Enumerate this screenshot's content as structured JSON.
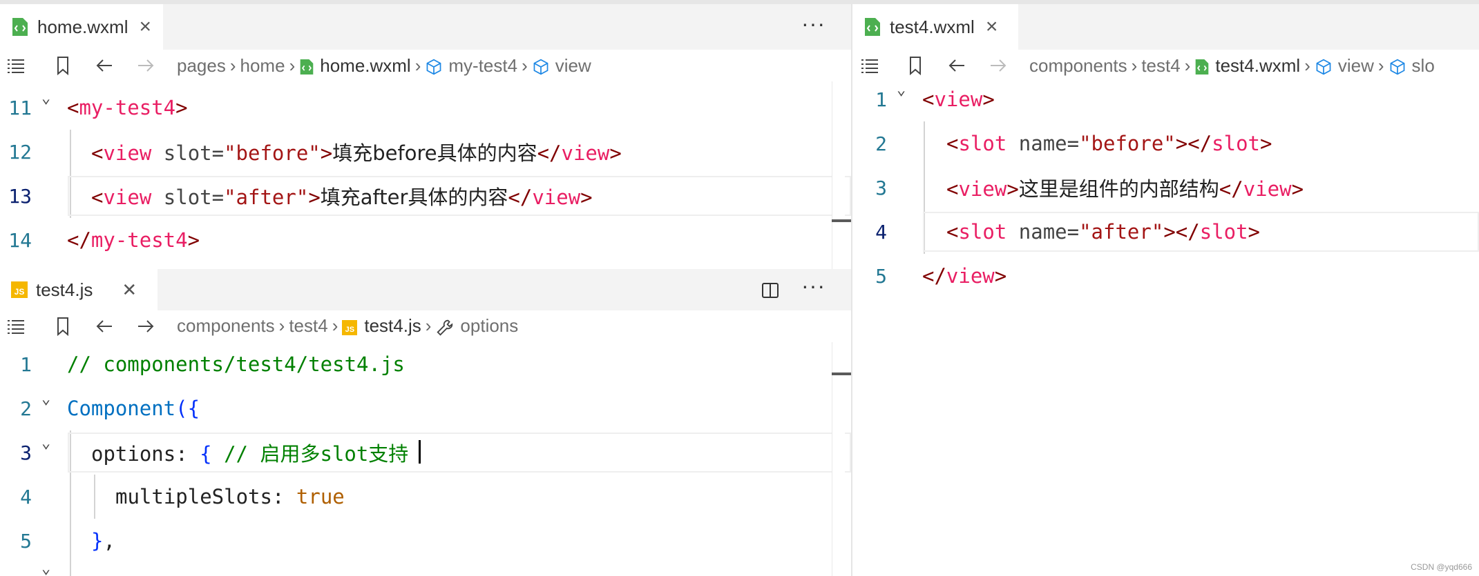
{
  "colors": {
    "tag": "#800000",
    "tagname": "#e91e63",
    "string": "#a31515",
    "comment": "#008000",
    "keyword": "#0070c1",
    "bool": "#af5f00"
  },
  "left_top": {
    "tab_label": "home.wxml",
    "tab_close": "×",
    "more": "···",
    "breadcrumb": [
      "pages",
      "home",
      "home.wxml",
      "my-test4",
      "view"
    ],
    "lines": [
      {
        "num": "11",
        "seg": [
          [
            "<",
            "t-tag"
          ],
          [
            "my-test4",
            "t-tagname"
          ],
          [
            ">",
            "t-tag"
          ]
        ]
      },
      {
        "num": "12",
        "seg": [
          [
            "<",
            "t-tag"
          ],
          [
            "view",
            "t-tagname"
          ],
          [
            " slot",
            "t-attr"
          ],
          [
            "=",
            "t-attr"
          ],
          [
            "\"before\"",
            "t-str"
          ],
          [
            ">",
            "t-tag"
          ],
          [
            "填充before具体的内容",
            "t-text"
          ],
          [
            "</",
            "t-tag"
          ],
          [
            "view",
            "t-tagname"
          ],
          [
            ">",
            "t-tag"
          ]
        ]
      },
      {
        "num": "13",
        "seg": [
          [
            "<",
            "t-tag"
          ],
          [
            "view",
            "t-tagname"
          ],
          [
            " slot",
            "t-attr"
          ],
          [
            "=",
            "t-attr"
          ],
          [
            "\"after\"",
            "t-str"
          ],
          [
            ">",
            "t-tag"
          ],
          [
            "填充after具体的内容",
            "t-text"
          ],
          [
            "</",
            "t-tag"
          ],
          [
            "view",
            "t-tagname"
          ],
          [
            ">",
            "t-tag"
          ]
        ]
      },
      {
        "num": "14",
        "seg": [
          [
            "</",
            "t-tag"
          ],
          [
            "my-test4",
            "t-tagname"
          ],
          [
            ">",
            "t-tag"
          ]
        ]
      }
    ]
  },
  "left_bottom": {
    "tab_label": "test4.js",
    "tab_close": "✕",
    "more": "···",
    "breadcrumb": [
      "components",
      "test4",
      "test4.js",
      "options"
    ],
    "lines": [
      {
        "num": "1",
        "seg": [
          [
            "// components/test4/test4.js",
            "t-com"
          ]
        ]
      },
      {
        "num": "2",
        "seg": [
          [
            "Component",
            "t-kw"
          ],
          [
            "(",
            "t-punc"
          ],
          [
            "{",
            "t-punc"
          ]
        ]
      },
      {
        "num": "3",
        "seg": [
          [
            "options",
            "t-prop"
          ],
          [
            ": ",
            "t-prop"
          ],
          [
            "{",
            "t-punc"
          ],
          [
            " // 启用多slot支持",
            "t-com"
          ]
        ]
      },
      {
        "num": "4",
        "seg": [
          [
            "multipleSlots",
            "t-prop"
          ],
          [
            ": ",
            "t-prop"
          ],
          [
            "true",
            "t-bool"
          ]
        ]
      },
      {
        "num": "5",
        "seg": [
          [
            "}",
            "t-punc"
          ],
          [
            ",",
            "t-prop"
          ]
        ]
      }
    ]
  },
  "right": {
    "tab_label": "test4.wxml",
    "tab_close": "×",
    "breadcrumb": [
      "components",
      "test4",
      "test4.wxml",
      "view",
      "slo"
    ],
    "lines": [
      {
        "num": "1",
        "seg": [
          [
            "<",
            "t-tag"
          ],
          [
            "view",
            "t-tagname"
          ],
          [
            ">",
            "t-tag"
          ]
        ]
      },
      {
        "num": "2",
        "seg": [
          [
            "<",
            "t-tag"
          ],
          [
            "slot",
            "t-tagname"
          ],
          [
            " name",
            "t-attr"
          ],
          [
            "=",
            "t-attr"
          ],
          [
            "\"before\"",
            "t-str"
          ],
          [
            "></",
            "t-tag"
          ],
          [
            "slot",
            "t-tagname"
          ],
          [
            ">",
            "t-tag"
          ]
        ]
      },
      {
        "num": "3",
        "seg": [
          [
            "<",
            "t-tag"
          ],
          [
            "view",
            "t-tagname"
          ],
          [
            ">",
            "t-tag"
          ],
          [
            "这里是组件的内部结构",
            "t-text"
          ],
          [
            "</",
            "t-tag"
          ],
          [
            "view",
            "t-tagname"
          ],
          [
            ">",
            "t-tag"
          ]
        ]
      },
      {
        "num": "4",
        "seg": [
          [
            "<",
            "t-tag"
          ],
          [
            "slot",
            "t-tagname"
          ],
          [
            " name",
            "t-attr"
          ],
          [
            "=",
            "t-attr"
          ],
          [
            "\"after\"",
            "t-str"
          ],
          [
            ">",
            "t-tag"
          ],
          [
            "</",
            "t-tag"
          ],
          [
            "slot",
            "t-tagname"
          ],
          [
            ">",
            "t-tag"
          ]
        ]
      },
      {
        "num": "5",
        "seg": [
          [
            "</",
            "t-tag"
          ],
          [
            "view",
            "t-tagname"
          ],
          [
            ">",
            "t-tag"
          ]
        ]
      }
    ]
  },
  "watermark": "CSDN @yqd666"
}
